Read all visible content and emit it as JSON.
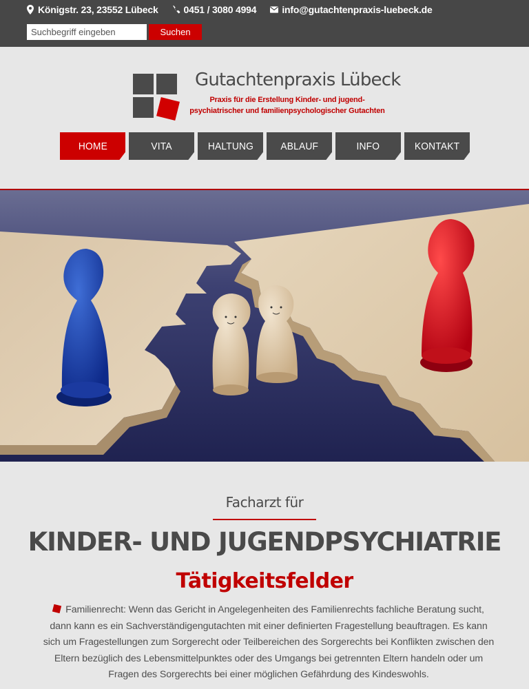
{
  "contact": {
    "address": "Königstr. 23, 23552 Lübeck",
    "phone": "0451 / 3080 4994",
    "email": "info@gutachtenpraxis-luebeck.de"
  },
  "search": {
    "placeholder": "Suchbegriff eingeben",
    "button_label": "Suchen"
  },
  "brand": {
    "title": "Gutachtenpraxis Lübeck",
    "tagline": "Praxis für die Erstellung Kinder- und jugend-psychiatrischer und familienpsychologischer Gutachten"
  },
  "nav": {
    "items": [
      {
        "label": "HOME",
        "active": true
      },
      {
        "label": "VITA",
        "active": false
      },
      {
        "label": "HALTUNG",
        "active": false
      },
      {
        "label": "ABLAUF",
        "active": false
      },
      {
        "label": "INFO",
        "active": false
      },
      {
        "label": "KONTAKT",
        "active": false
      }
    ]
  },
  "content": {
    "subheading": "Facharzt für",
    "heading": "KINDER- UND JUGENDPSYCHIATRIE",
    "section_title": "Tätigkeitsfelder",
    "paragraph": "Familienrecht: Wenn das Gericht in Angelegenheiten des Familienrechts fachliche Beratung sucht, dann kann es ein Sachverständigengutachten mit einer definierten Fragestellung beauftragen. Es kann sich um Fragestellungen zum Sorgerecht oder Teilbereichen des Sorgerechts bei Konflikten zwischen den Eltern bezüglich des Lebensmittelpunktes oder des Umgangs bei getrennten Eltern handeln oder um Fragen des Sorgerechts bei einer möglichen Gefährdung des Kindeswohls."
  },
  "icons": {
    "address": "map-marker-icon",
    "phone": "phone-icon",
    "email": "envelope-icon",
    "bullet": "red-square-bullet-icon"
  },
  "colors": {
    "topbar": "#474747",
    "accent": "#cc0000",
    "nav": "#4a4a4a",
    "background": "#e7e7e7"
  }
}
